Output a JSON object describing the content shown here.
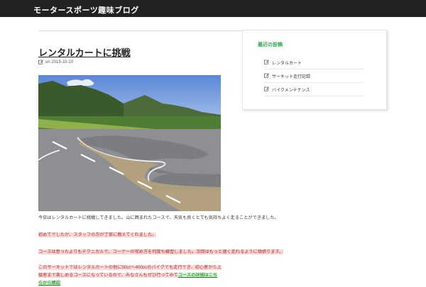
{
  "header": {
    "site_title": "モータースポーツ趣味ブログ"
  },
  "post": {
    "title": "レンタルカートに挑戦",
    "meta": "on 2019-10-10",
    "image_alt": "カートコースの写真",
    "paragraphs": {
      "p1": "今日はレンタルカートに挑戦してきました。山に囲まれたコースで、天気も良くとても気持ちよく走ることができました。",
      "p2": "初めてでしたが、スタッフの方が丁寧に教えてくれました。",
      "p3": "コースは思ったよりもテクニカルで、コーナーの攻め方を何度も練習しました。次回はもっと速く走れるように頑張ります。",
      "p4a": "このサーキットではレンタルカートの他に50cc〜400ccのバイクでも走行でき、初心者から上級者まで楽しめるコースになっているので、みなさんも",
      "p4b": "ぜひ行ってみて",
      "p4c": "コースの詳細はこちらから確認"
    }
  },
  "sidebar": {
    "widget_title": "最近の投稿",
    "items": [
      {
        "label": "レンタルカート"
      },
      {
        "label": "サーキット走行記録"
      },
      {
        "label": "バイクメンテナンス"
      }
    ]
  },
  "colors": {
    "topbar": "#222222",
    "accent_green": "#2fa84f",
    "highlight_red": "#fbdada"
  },
  "icons": {
    "meta": "edit-icon",
    "list": "edit-icon"
  }
}
